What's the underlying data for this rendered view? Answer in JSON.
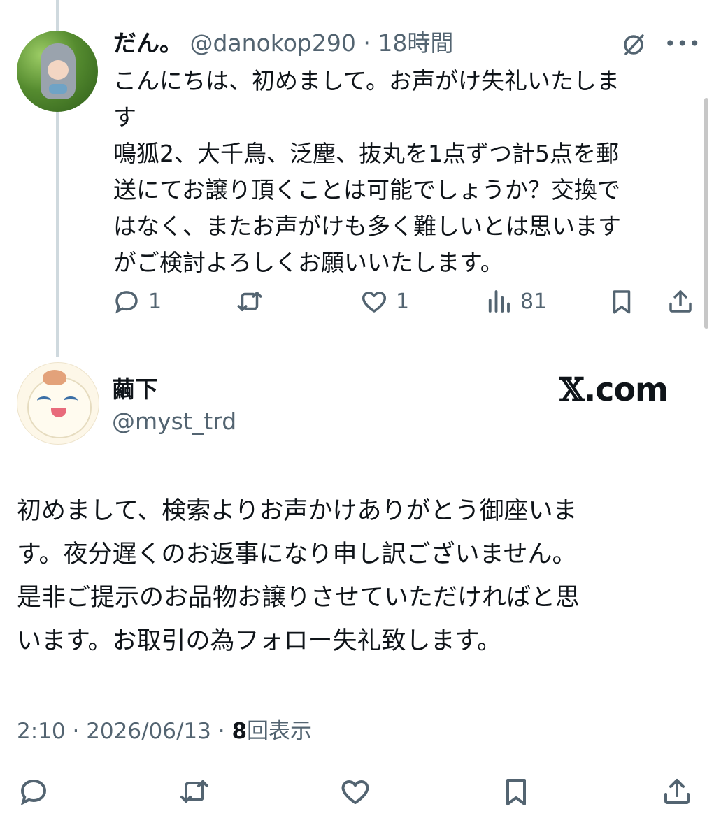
{
  "reply_tweet": {
    "display_name": "だん。",
    "handle": "@danokop290",
    "separator": "·",
    "time_ago": "18時間",
    "text_lines": [
      "こんにちは、初めまして。お声がけ失礼いたしま",
      "す",
      "鳴狐2、大千鳥、泛塵、抜丸を1点ずつ計5点を郵",
      "送にてお譲り頂くことは可能でしょうか？交換で",
      "はなく、またお声がけも多く難しいとは思います",
      "がご検討よろしくお願いいたします。"
    ],
    "stats": {
      "replies": "1",
      "likes": "1",
      "views": "81"
    },
    "icons": [
      "grok-icon",
      "more-icon",
      "reply-icon",
      "retweet-icon",
      "like-icon",
      "views-icon",
      "bookmark-icon",
      "share-icon"
    ]
  },
  "main_tweet": {
    "display_name": "繭下",
    "handle": "@myst_trd",
    "brand": {
      "x": "𝕏",
      "rest": ".com"
    },
    "text_lines": [
      "初めまして、検索よりお声かけありがとう御座いま",
      "す。夜分遅くのお返事になり申し訳ございません。",
      "是非ご提示のお品物お譲りさせていただければと思",
      "います。お取引の為フォロー失礼致します。"
    ],
    "time": "2:10",
    "separator": "·",
    "date": "2026/06/13",
    "views_count": "8",
    "views_label": "回表示",
    "icons": [
      "reply-icon",
      "retweet-icon",
      "like-icon",
      "bookmark-icon",
      "share-icon"
    ]
  },
  "colors": {
    "text": "#0f1419",
    "secondary": "#536471",
    "thread_line": "#cfd9de",
    "background": "#ffffff"
  }
}
